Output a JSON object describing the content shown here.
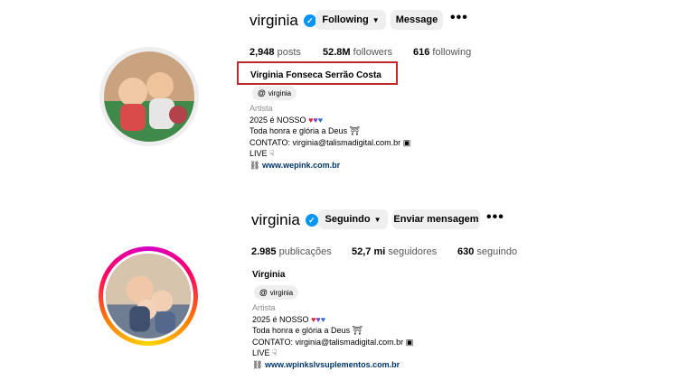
{
  "profile_en": {
    "username": "virginia",
    "buttons": {
      "following": "Following",
      "message": "Message"
    },
    "stats": [
      {
        "value": "2,948",
        "label": "posts"
      },
      {
        "value": "52.8M",
        "label": "followers"
      },
      {
        "value": "616",
        "label": "following"
      }
    ],
    "full_name": "Virginia Fonseca Serrão Costa",
    "threads_label": "virginia",
    "bio": {
      "category": "Artista",
      "line1": "2025 é NOSSO",
      "line2": "Toda honra e glória a Deus",
      "line3": "CONTATO: virginia@talismadigital.com.br",
      "line4": "LIVE",
      "link": "www.wepink.com.br"
    }
  },
  "profile_pt": {
    "username": "virginia",
    "buttons": {
      "following": "Seguindo",
      "message": "Enviar mensagem"
    },
    "stats": [
      {
        "value": "2.985",
        "label": "publicações"
      },
      {
        "value": "52,7 mi",
        "label": "seguidores"
      },
      {
        "value": "630",
        "label": "seguindo"
      }
    ],
    "full_name": "Virginia",
    "threads_label": "virginia",
    "bio": {
      "category": "Artista",
      "line1": "2025 é NOSSO",
      "line2": "Toda honra e glória a Deus",
      "line3": "CONTATO: virginia@talismadigital.com.br",
      "line4": "LIVE",
      "link": "www.wpinkslvsuplementos.com.br"
    }
  },
  "colors": {
    "verified": "#0095f6",
    "highlight": "#c0282d",
    "link": "#00376b"
  },
  "icons": [
    "verified-badge-icon",
    "chevron-down-icon",
    "more-options-icon",
    "threads-icon",
    "link-icon",
    "heart-red-icon",
    "heart-purple-icon",
    "heart-blue-icon",
    "praying-hands-icon",
    "inbox-icon",
    "pointing-hand-icon"
  ]
}
